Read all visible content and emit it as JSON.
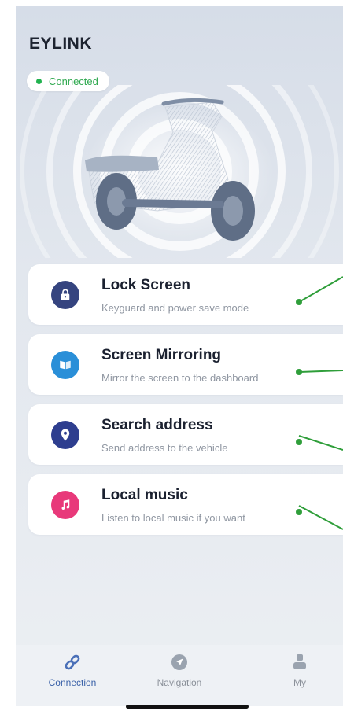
{
  "app": {
    "title": "EYLINK"
  },
  "status": {
    "label": "Connected",
    "color": "#21b24f"
  },
  "features": [
    {
      "name": "Lock Screen",
      "desc": "Keyguard and power save mode",
      "icon": "lock-icon",
      "color": "#35447f"
    },
    {
      "name": "Screen Mirroring",
      "desc": "Mirror the screen to the dashboard",
      "icon": "mirror-icon",
      "color": "#2a8fd8"
    },
    {
      "name": "Search address",
      "desc": "Send address to the vehicle",
      "icon": "location-pin-icon",
      "color": "#2e3e8f"
    },
    {
      "name": "Local music",
      "desc": "Listen to local music if you want",
      "icon": "music-note-icon",
      "color": "#e8397a"
    }
  ],
  "tabs": [
    {
      "label": "Connection",
      "icon": "link-icon",
      "active": true
    },
    {
      "label": "Navigation",
      "icon": "navigation-arrow-icon",
      "active": false
    },
    {
      "label": "My",
      "icon": "person-icon",
      "active": false
    }
  ],
  "accent": "#3a61a8"
}
